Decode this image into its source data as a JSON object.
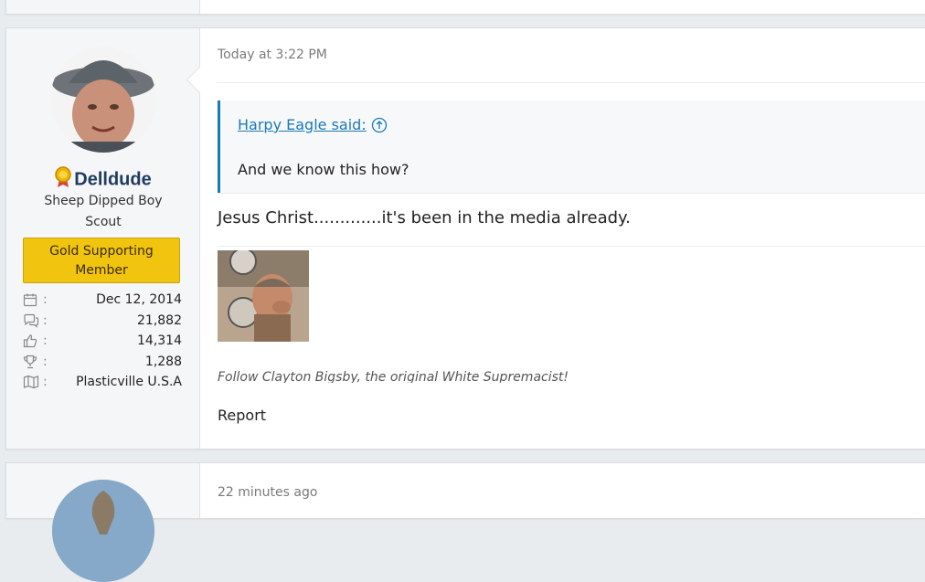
{
  "main_post": {
    "author": {
      "username": "Delldude",
      "user_title": "Sheep Dipped Boy Scout",
      "banner": "Gold Supporting Member",
      "stats": [
        {
          "icon": "calendar-icon",
          "value": "Dec 12, 2014"
        },
        {
          "icon": "messages-icon",
          "value": "21,882"
        },
        {
          "icon": "thumbs-up-icon",
          "value": "14,314"
        },
        {
          "icon": "trophy-icon",
          "value": "1,288"
        },
        {
          "icon": "map-icon",
          "value": "Plasticville U.S.A"
        }
      ],
      "colon": ":"
    },
    "timestamp": "Today at 3:22 PM",
    "quote": {
      "author_link": "Harpy Eagle said:",
      "text": "And we know this how?"
    },
    "message": "Jesus Christ.............it's been in the media already.",
    "signature": "Follow Clayton Bigsby, the original White Supremacist!",
    "report_label": "Report"
  },
  "next_post": {
    "timestamp": "22 minutes ago"
  },
  "colors": {
    "accent": "#1a7ab8",
    "gold": "#f1c40f",
    "username": "#1f3b5f"
  }
}
